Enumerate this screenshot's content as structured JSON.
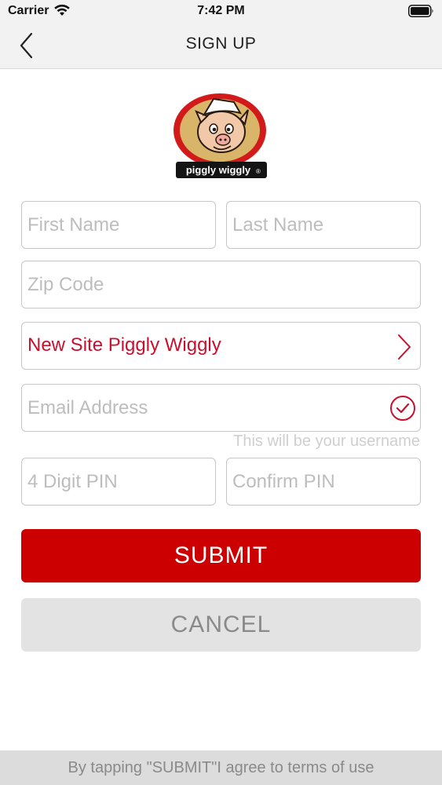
{
  "status_bar": {
    "carrier": "Carrier",
    "time": "7:42 PM",
    "wifi_icon": "wifi-icon",
    "battery_icon": "battery-icon"
  },
  "nav": {
    "title": "SIGN UP",
    "back_icon": "chevron-left-icon"
  },
  "logo": {
    "text": "piggly wiggly",
    "mark": "®"
  },
  "form": {
    "first_name": {
      "placeholder": "First Name",
      "value": ""
    },
    "last_name": {
      "placeholder": "Last Name",
      "value": ""
    },
    "zip_code": {
      "placeholder": "Zip Code",
      "value": ""
    },
    "store": {
      "value": "New Site Piggly Wiggly",
      "icon": "chevron-right-icon"
    },
    "email": {
      "placeholder": "Email Address",
      "value": "",
      "icon": "check-circle-icon",
      "hint": "This will be your username"
    },
    "pin": {
      "placeholder": "4 Digit PIN",
      "value": ""
    },
    "confirm_pin": {
      "placeholder": "Confirm PIN",
      "value": ""
    }
  },
  "actions": {
    "submit": "SUBMIT",
    "cancel": "CANCEL"
  },
  "footer": {
    "terms": "By tapping \"SUBMIT\"I agree to terms of use"
  },
  "colors": {
    "brand_red": "#cc0000",
    "accent_red": "#c8102e",
    "cancel_bg": "#e3e3e3",
    "nav_bg": "#f2f2f2"
  }
}
